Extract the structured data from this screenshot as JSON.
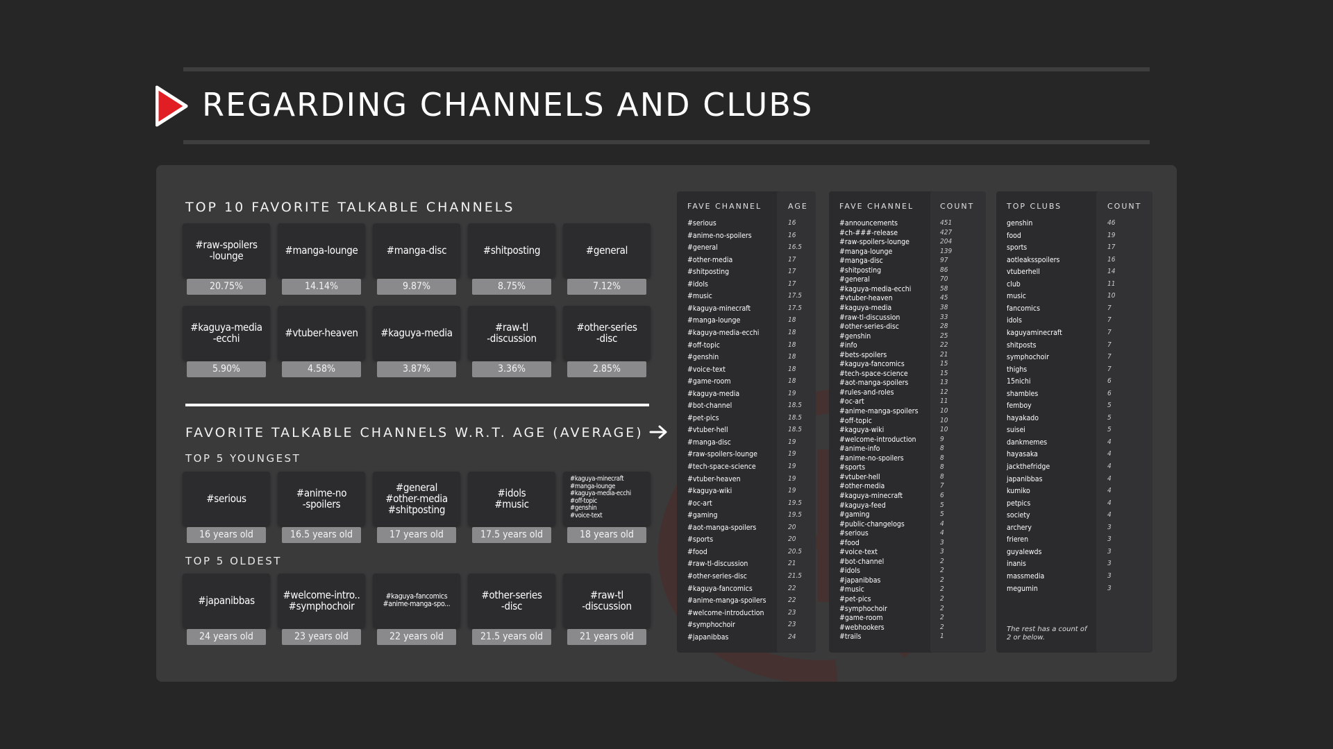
{
  "header": {
    "title": "REGARDING CHANNELS AND CLUBS"
  },
  "top10": {
    "heading": "TOP 10 FAVORITE TALKABLE CHANNELS",
    "items": [
      {
        "name": "#raw-spoilers\n-lounge",
        "pct": "20.75%"
      },
      {
        "name": "#manga-lounge",
        "pct": "14.14%"
      },
      {
        "name": "#manga-disc",
        "pct": "9.87%"
      },
      {
        "name": "#shitposting",
        "pct": "8.75%"
      },
      {
        "name": "#general",
        "pct": "7.12%"
      },
      {
        "name": "#kaguya-media\n-ecchi",
        "pct": "5.90%"
      },
      {
        "name": "#vtuber-heaven",
        "pct": "4.58%"
      },
      {
        "name": "#kaguya-media",
        "pct": "3.87%"
      },
      {
        "name": "#raw-tl\n-discussion",
        "pct": "3.36%"
      },
      {
        "name": "#other-series\n-disc",
        "pct": "2.85%"
      }
    ]
  },
  "age": {
    "heading": "FAVORITE TALKABLE CHANNELS W.R.T. AGE (AVERAGE)",
    "youngest_heading": "TOP 5 YOUNGEST",
    "oldest_heading": "TOP 5 OLDEST",
    "youngest": [
      {
        "name": "#serious",
        "age": "16 years old"
      },
      {
        "name": "#anime-no\n-spoilers",
        "age": "16.5 years old"
      },
      {
        "name": "#general\n#other-media\n#shitposting",
        "age": "17 years old"
      },
      {
        "name": "#idols\n#music",
        "age": "17.5 years old"
      },
      {
        "name": "#kaguya-minecraft\n#manga-lounge\n#kaguya-media-ecchi\n#off-topic\n#genshin\n#voice-text",
        "age": "18 years old"
      }
    ],
    "oldest": [
      {
        "name": "#japanibbas",
        "age": "24 years old"
      },
      {
        "name": "#welcome-intro..\n#symphochoir",
        "age": "23 years old"
      },
      {
        "name": "#kaguya-fancomics\n#anime-manga-spo...",
        "age": "22 years old"
      },
      {
        "name": "#other-series\n-disc",
        "age": "21.5 years old"
      },
      {
        "name": "#raw-tl\n-discussion",
        "age": "21 years old"
      }
    ]
  },
  "table_age": {
    "headers": [
      "FAVE CHANNEL",
      "AGE"
    ],
    "rows": [
      [
        "#serious",
        "16"
      ],
      [
        "#anime-no-spoilers",
        "16"
      ],
      [
        "#general",
        "16.5"
      ],
      [
        "#other-media",
        "17"
      ],
      [
        "#shitposting",
        "17"
      ],
      [
        "#idols",
        "17"
      ],
      [
        "#music",
        "17.5"
      ],
      [
        "#kaguya-minecraft",
        "17.5"
      ],
      [
        "#manga-lounge",
        "18"
      ],
      [
        "#kaguya-media-ecchi",
        "18"
      ],
      [
        "#off-topic",
        "18"
      ],
      [
        "#genshin",
        "18"
      ],
      [
        "#voice-text",
        "18"
      ],
      [
        "#game-room",
        "18"
      ],
      [
        "#kaguya-media",
        "19"
      ],
      [
        "#bot-channel",
        "18.5"
      ],
      [
        "#pet-pics",
        "18.5"
      ],
      [
        "#vtuber-hell",
        "18.5"
      ],
      [
        "#manga-disc",
        "19"
      ],
      [
        "#raw-spoilers-lounge",
        "19"
      ],
      [
        "#tech-space-science",
        "19"
      ],
      [
        "#vtuber-heaven",
        "19"
      ],
      [
        "#kaguya-wiki",
        "19"
      ],
      [
        "#oc-art",
        "19.5"
      ],
      [
        "#gaming",
        "19.5"
      ],
      [
        "#aot-manga-spoilers",
        "20"
      ],
      [
        "#sports",
        "20"
      ],
      [
        "#food",
        "20.5"
      ],
      [
        "#raw-tl-discussion",
        "21"
      ],
      [
        "#other-series-disc",
        "21.5"
      ],
      [
        "#kaguya-fancomics",
        "22"
      ],
      [
        "#anime-manga-spoilers",
        "22"
      ],
      [
        "#welcome-introduction",
        "23"
      ],
      [
        "#symphochoir",
        "23"
      ],
      [
        "#japanibbas",
        "24"
      ]
    ]
  },
  "table_count": {
    "headers": [
      "FAVE CHANNEL",
      "COUNT"
    ],
    "rows": [
      [
        "#announcements",
        "451"
      ],
      [
        "#ch-###-release",
        "427"
      ],
      [
        "#raw-spoilers-lounge",
        "204"
      ],
      [
        "#manga-lounge",
        "139"
      ],
      [
        "#manga-disc",
        "97"
      ],
      [
        "#shitposting",
        "86"
      ],
      [
        "#general",
        "70"
      ],
      [
        "#kaguya-media-ecchi",
        "58"
      ],
      [
        "#vtuber-heaven",
        "45"
      ],
      [
        "#kaguya-media",
        "38"
      ],
      [
        "#raw-tl-discussion",
        "33"
      ],
      [
        "#other-series-disc",
        "28"
      ],
      [
        "#genshin",
        "25"
      ],
      [
        "#info",
        "22"
      ],
      [
        "#bets-spoilers",
        "21"
      ],
      [
        "#kaguya-fancomics",
        "15"
      ],
      [
        "#tech-space-science",
        "15"
      ],
      [
        "#aot-manga-spoilers",
        "13"
      ],
      [
        "#rules-and-roles",
        "12"
      ],
      [
        "#oc-art",
        "11"
      ],
      [
        "#anime-manga-spoilers",
        "10"
      ],
      [
        "#off-topic",
        "10"
      ],
      [
        "#kaguya-wiki",
        "10"
      ],
      [
        "#welcome-introduction",
        "9"
      ],
      [
        "#anime-info",
        "8"
      ],
      [
        "#anime-no-spoilers",
        "8"
      ],
      [
        "#sports",
        "8"
      ],
      [
        "#vtuber-hell",
        "8"
      ],
      [
        "#other-media",
        "7"
      ],
      [
        "#kaguya-minecraft",
        "6"
      ],
      [
        "#kaguya-feed",
        "5"
      ],
      [
        "#gaming",
        "5"
      ],
      [
        "#public-changelogs",
        "4"
      ],
      [
        "#serious",
        "4"
      ],
      [
        "#food",
        "3"
      ],
      [
        "#voice-text",
        "3"
      ],
      [
        "#bot-channel",
        "2"
      ],
      [
        "#idols",
        "2"
      ],
      [
        "#japanibbas",
        "2"
      ],
      [
        "#music",
        "2"
      ],
      [
        "#pet-pics",
        "2"
      ],
      [
        "#symphochoir",
        "2"
      ],
      [
        "#game-room",
        "2"
      ],
      [
        "#webhookers",
        "2"
      ],
      [
        "#trails",
        "1"
      ]
    ]
  },
  "table_clubs": {
    "headers": [
      "TOP CLUBS",
      "COUNT"
    ],
    "rows": [
      [
        "genshin",
        "46"
      ],
      [
        "food",
        "19"
      ],
      [
        "sports",
        "17"
      ],
      [
        "aotleaksspoilers",
        "16"
      ],
      [
        "vtuberhell",
        "14"
      ],
      [
        "club",
        "11"
      ],
      [
        "music",
        "10"
      ],
      [
        "fancomics",
        "7"
      ],
      [
        "idols",
        "7"
      ],
      [
        "kaguyaminecraft",
        "7"
      ],
      [
        "shitposts",
        "7"
      ],
      [
        "symphochoir",
        "7"
      ],
      [
        "thighs",
        "7"
      ],
      [
        "15nichi",
        "6"
      ],
      [
        "shambles",
        "6"
      ],
      [
        "femboy",
        "5"
      ],
      [
        "hayakado",
        "5"
      ],
      [
        "suisei",
        "5"
      ],
      [
        "dankmemes",
        "4"
      ],
      [
        "hayasaka",
        "4"
      ],
      [
        "jackthefridge",
        "4"
      ],
      [
        "japanibbas",
        "4"
      ],
      [
        "kumiko",
        "4"
      ],
      [
        "petpics",
        "4"
      ],
      [
        "society",
        "4"
      ],
      [
        "archery",
        "3"
      ],
      [
        "frieren",
        "3"
      ],
      [
        "guyalewds",
        "3"
      ],
      [
        "inanis",
        "3"
      ],
      [
        "massmedia",
        "3"
      ],
      [
        "megumin",
        "3"
      ]
    ],
    "note": "The rest has a count of 2 or below."
  }
}
